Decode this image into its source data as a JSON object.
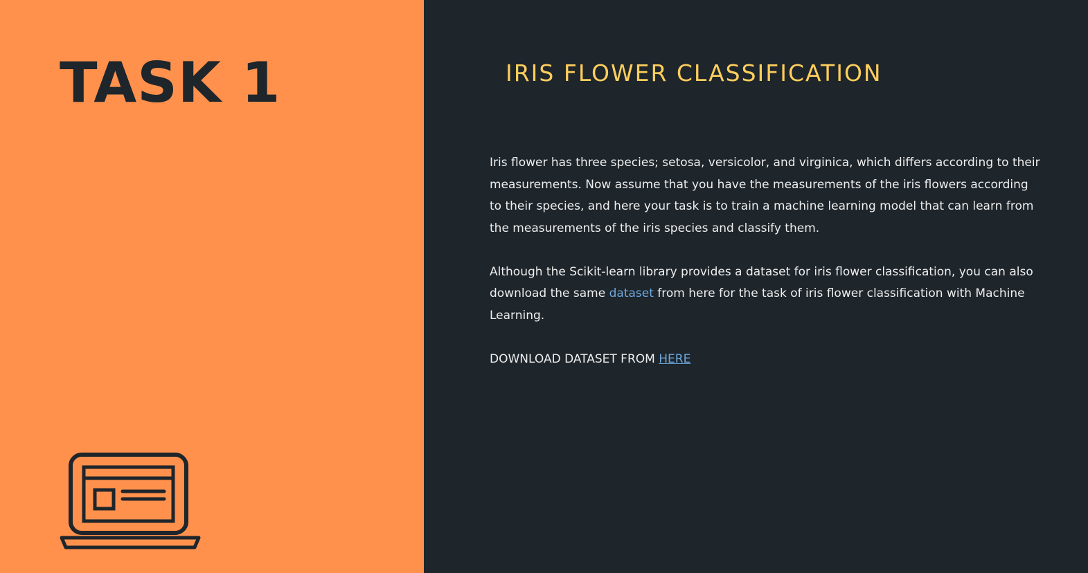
{
  "left": {
    "title": "TASK 1",
    "icon": "laptop-icon",
    "background_color": "#FF914D"
  },
  "right": {
    "title": "IRIS FLOWER CLASSIFICATION",
    "title_color": "#FFCE5C",
    "background_color": "#1E252B",
    "paragraph1": "Iris flower has three species; setosa, versicolor, and virginica, which differs according to their measurements. Now assume that you have the measurements of the iris flowers according to their species, and here your task is to train a machine learning model that can learn from the measurements of the iris species and classify them.",
    "paragraph2_before": "Although the Scikit-learn library provides a dataset for iris flower classification, you can also download the same ",
    "paragraph2_link": "dataset",
    "paragraph2_after": " from here for the task of iris flower classification with Machine Learning.",
    "download_label": "DOWNLOAD DATASET FROM ",
    "download_link": "HERE",
    "link_color": "#6FA8DC"
  }
}
